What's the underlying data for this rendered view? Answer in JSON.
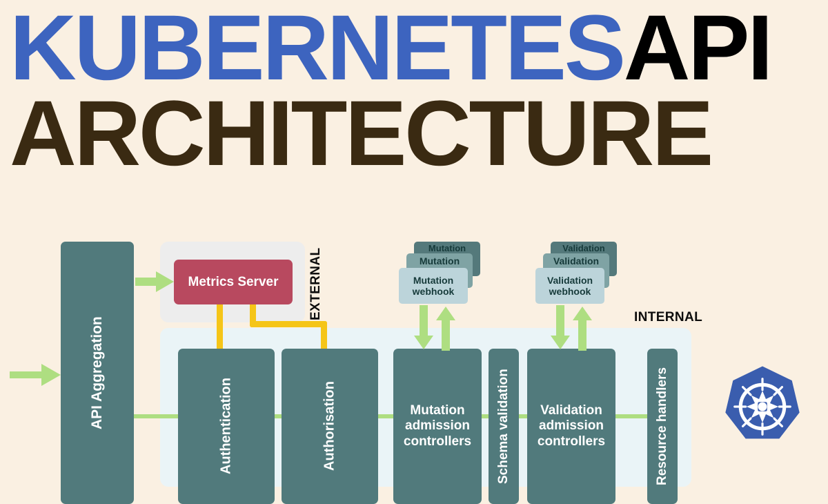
{
  "title": {
    "line1_part1": "KUBERNETES",
    "line1_part2": "API",
    "line2": "ARCHITECTURE",
    "colors": {
      "kubernetes": "#3d64bf",
      "api": "#000000",
      "architecture": "#3a2a12"
    }
  },
  "palette": {
    "background": "#faf0e2",
    "box_teal": "#517a7c",
    "metrics_red": "#b8495f",
    "flow_green": "#aede81",
    "connector_yellow": "#f5c518",
    "panel_external_bg": "#ededed",
    "panel_internal_bg": "#eaf4f7",
    "k8s_blue": "#3a5dae",
    "card_back": "#54797b",
    "card_mid": "#7fa3a4",
    "card_front": "#bcd4da"
  },
  "panels": [
    {
      "id": "external",
      "label": "EXTERNAL",
      "orientation": "vertical"
    },
    {
      "id": "internal",
      "label": "INTERNAL",
      "orientation": "horizontal"
    }
  ],
  "boxes": {
    "api_aggregation": "API Aggregation",
    "metrics_server": "Metrics Server",
    "authentication": "Authentication",
    "authorisation": "Authorisation",
    "mutation_admission_controllers": "Mutation admission controllers",
    "schema_validation": "Schema validation",
    "validation_admission_controllers": "Validation admission controllers",
    "resource_handlers": "Resource handlers"
  },
  "webhook_stacks": [
    {
      "id": "mutation",
      "cards": [
        {
          "label": "Mutation",
          "layer": "back"
        },
        {
          "label": "Mutation",
          "layer": "mid"
        },
        {
          "label": "Mutation webhook",
          "layer": "front"
        }
      ]
    },
    {
      "id": "validation",
      "cards": [
        {
          "label": "Validation",
          "layer": "back"
        },
        {
          "label": "Validation",
          "layer": "mid"
        },
        {
          "label": "Validation webhook",
          "layer": "front"
        }
      ]
    }
  ],
  "icons": {
    "entry_arrow": "arrow-right-icon",
    "metrics_arrow": "arrow-right-icon",
    "webhook_down": "arrow-down-icon",
    "webhook_up": "arrow-up-icon",
    "logo": "kubernetes-logo-icon"
  }
}
